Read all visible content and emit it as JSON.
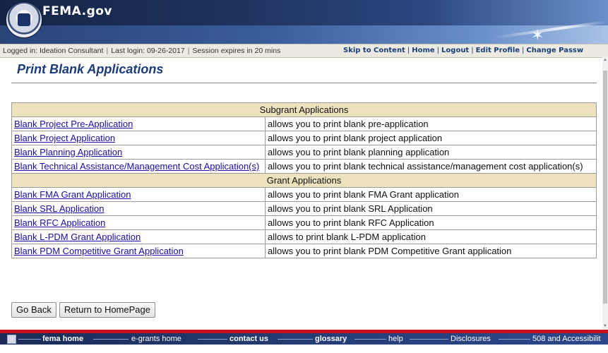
{
  "header": {
    "brand": "FEMA.gov"
  },
  "status": {
    "logged_in": "Logged in: Ideation Consultant",
    "last_login": "Last login: 09-26-2017",
    "session": "Session expires in 20 mins",
    "links": [
      "Skip to Content",
      "Home",
      "Logout",
      "Edit Profile",
      "Change Passw"
    ]
  },
  "page": {
    "title": "Print Blank Applications"
  },
  "table": {
    "sections": [
      {
        "heading": "Subgrant Applications",
        "rows": [
          {
            "link": "Blank Project Pre-Application",
            "desc": "allows you to print blank pre-application"
          },
          {
            "link": "Blank Project Application",
            "desc": "allows you to print blank project application"
          },
          {
            "link": "Blank Planning Application",
            "desc": "allows you to print blank planning application"
          },
          {
            "link": "Blank Technical Assistance/Management Cost Application(s)",
            "desc": "allows you to print blank technical assistance/management cost application(s)"
          }
        ]
      },
      {
        "heading": "Grant Applications",
        "rows": [
          {
            "link": "Blank FMA Grant Application",
            "desc": "allows you to print blank FMA Grant application"
          },
          {
            "link": "Blank SRL Application",
            "desc": "allows you to print blank SRL Application"
          },
          {
            "link": "Blank RFC Application",
            "desc": "allows you to print blank RFC Application"
          },
          {
            "link": "Blank L-PDM Grant Application",
            "desc": "allows to print blank L-PDM application"
          },
          {
            "link": "Blank PDM Competitive Grant Application",
            "desc": "allows you to print blank PDM Competitive Grant application"
          }
        ]
      }
    ]
  },
  "buttons": {
    "back": "Go Back",
    "home": "Return to HomePage"
  },
  "footer": {
    "links": [
      "fema home",
      "e-grants home",
      "contact us",
      "glossary",
      "help",
      "Disclosures",
      "508 and Accessibilit"
    ]
  },
  "colors": {
    "section_bg": "#ede2be",
    "footer_red": "#c8101d",
    "title_blue": "#1b3b79"
  }
}
